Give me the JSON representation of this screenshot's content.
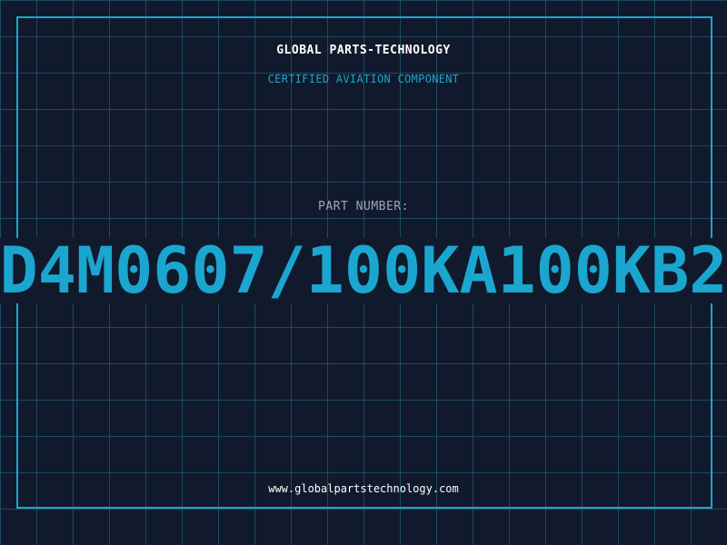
{
  "header": {
    "brand": "GLOBAL PARTS-TECHNOLOGY",
    "subtitle": "CERTIFIED AVIATION COMPONENT"
  },
  "part": {
    "label": "PART NUMBER:",
    "number": "D4M0607/100KA100KB2"
  },
  "footer": {
    "website": "www.globalpartstechnology.com"
  },
  "colors": {
    "background": "#111a2c",
    "grid": "#286e8c",
    "accent": "#1ba6cf",
    "text": "#ffffff",
    "muted": "#9aa7b8"
  }
}
